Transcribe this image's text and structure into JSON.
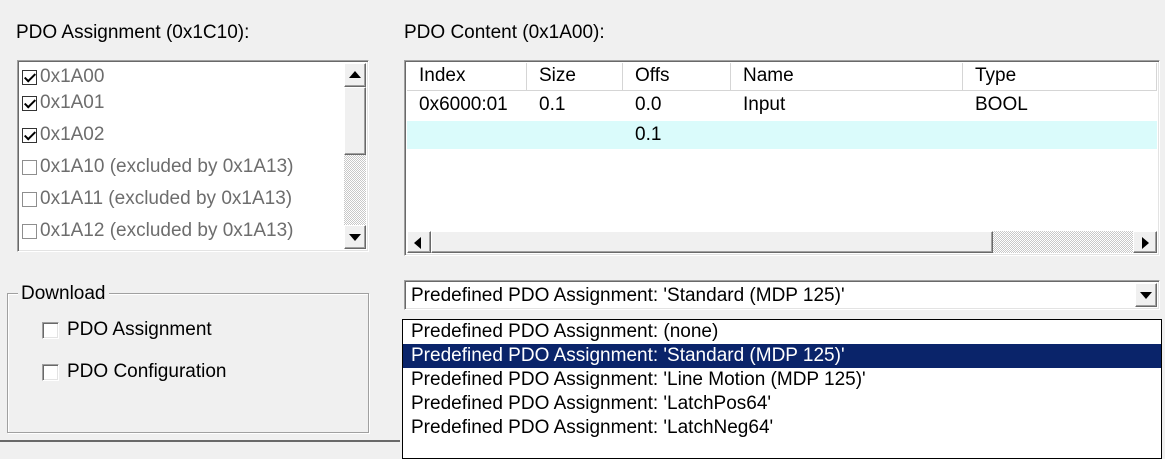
{
  "assignment": {
    "title": "PDO Assignment (0x1C10):",
    "items": [
      {
        "label": "0x1A00",
        "checked": true
      },
      {
        "label": "0x1A01",
        "checked": true
      },
      {
        "label": "0x1A02",
        "checked": true
      },
      {
        "label": "0x1A10 (excluded by 0x1A13)",
        "checked": false
      },
      {
        "label": "0x1A11 (excluded by 0x1A13)",
        "checked": false
      },
      {
        "label": "0x1A12 (excluded by 0x1A13)",
        "checked": false
      }
    ]
  },
  "content": {
    "title": "PDO Content (0x1A00):",
    "columns": [
      "Index",
      "Size",
      "Offs",
      "Name",
      "Type"
    ],
    "rows": [
      [
        "0x6000:01",
        "0.1",
        "0.0",
        "Input",
        "BOOL"
      ],
      [
        "",
        "",
        "0.1",
        "",
        ""
      ]
    ]
  },
  "download": {
    "title": "Download",
    "pdo_assignment": "PDO Assignment",
    "pdo_configuration": "PDO Configuration"
  },
  "predefined": {
    "selected": "Predefined PDO Assignment: 'Standard (MDP 125)'",
    "options": [
      "Predefined PDO Assignment: (none)",
      "Predefined PDO Assignment: 'Standard (MDP 125)'",
      "Predefined PDO Assignment: 'Line Motion (MDP 125)'",
      "Predefined PDO Assignment: 'LatchPos64'",
      "Predefined PDO Assignment: 'LatchNeg64'"
    ]
  },
  "colors": {
    "highlight_row": "#dafbfb",
    "selected_option": "#0a246a"
  }
}
